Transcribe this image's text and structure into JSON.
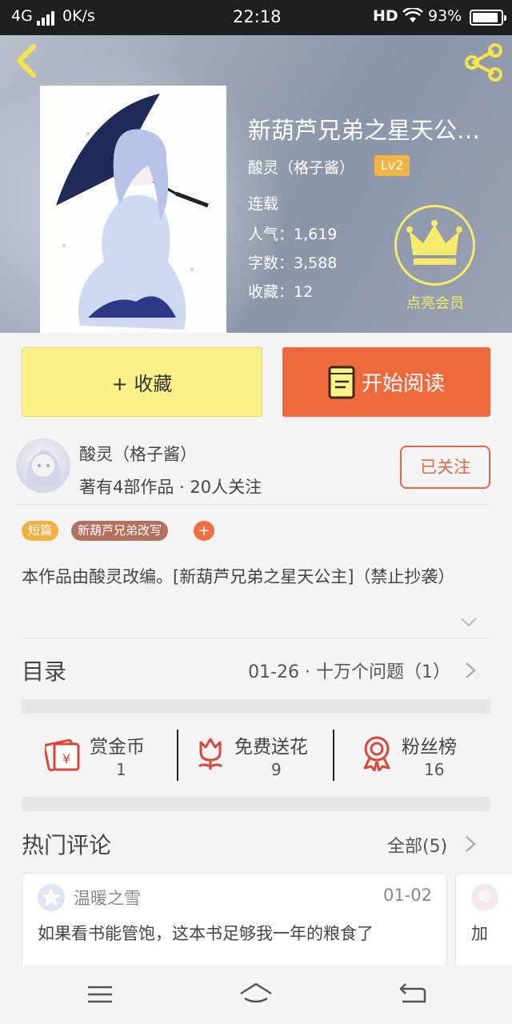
{
  "status_bar": {
    "network": "4G",
    "speed": "0K/s",
    "time": "22:18",
    "hd": "HD",
    "battery": "93%"
  },
  "book": {
    "title": "新葫芦兄弟之星天公…",
    "author": "酸灵（格子酱）",
    "level": "Lv2",
    "status": "连载",
    "popularity": "人气：1,619",
    "word_count": "字数：3,588",
    "collections": "收藏：12"
  },
  "vip": {
    "label": "点亮会员"
  },
  "actions": {
    "collect_label": "+ 收藏",
    "read_label": "开始阅读"
  },
  "author_card": {
    "name": "酸灵（格子酱）",
    "stats": "著有4部作品 · 20人关注",
    "follow_label": "已关注"
  },
  "tags": [
    {
      "label": "短篇"
    },
    {
      "label": "新葫芦兄弟改写"
    },
    {
      "label": "+"
    }
  ],
  "synopsis": "本作品由酸灵改编。[新葫芦兄弟之星天公主]（禁止抄袭）",
  "catalog": {
    "label": "目录",
    "latest": "01-26 · 十万个问题（1）"
  },
  "rewards": [
    {
      "label": "赏金币",
      "count": "1"
    },
    {
      "label": "免费送花",
      "count": "9"
    },
    {
      "label": "粉丝榜",
      "count": "16"
    }
  ],
  "comments": {
    "title": "热门评论",
    "all_label": "全部(5)",
    "items": [
      {
        "user": "温暖之雪",
        "date": "01-02",
        "text": "如果看书能管饱，这本书足够我一年的粮食了"
      },
      {
        "text": "加"
      }
    ]
  },
  "colors": {
    "accent_orange": "#ee6a3d",
    "collect_yellow": "#fbf289",
    "vip_yellow": "#f6eb6a",
    "tag_short": "#f2b041",
    "tag_rewrite": "#b4705e",
    "reward_red": "#d9463a"
  },
  "icons": [
    "back-arrow-icon",
    "share-icon",
    "crown-icon",
    "book-icon",
    "red-envelope-icon",
    "flower-icon",
    "medal-icon",
    "chevron-right-icon",
    "chevron-down-icon",
    "menu-icon",
    "home-icon",
    "return-icon"
  ]
}
